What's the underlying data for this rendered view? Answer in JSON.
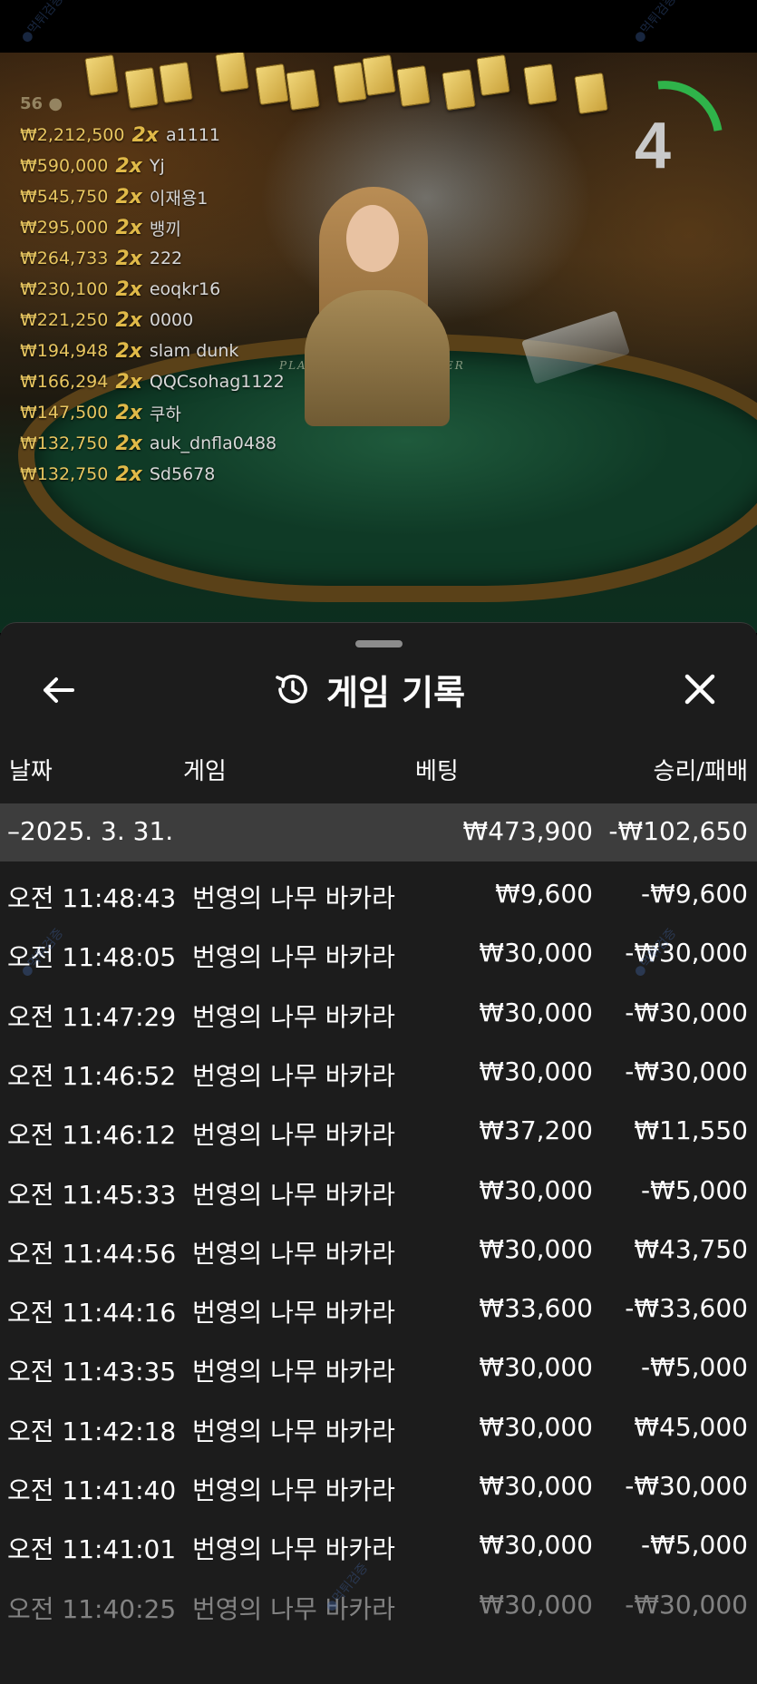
{
  "scene": {
    "online_count": "56",
    "timer_value": "4",
    "table_labels": [
      "PLAYER",
      "BANKER"
    ],
    "bets": [
      {
        "amount": "₩2,212,500",
        "mult": "2x",
        "name": "a1111"
      },
      {
        "amount": "₩590,000",
        "mult": "2x",
        "name": "Yj"
      },
      {
        "amount": "₩545,750",
        "mult": "2x",
        "name": "이재용1"
      },
      {
        "amount": "₩295,000",
        "mult": "2x",
        "name": "뱅끼"
      },
      {
        "amount": "₩264,733",
        "mult": "2x",
        "name": "222"
      },
      {
        "amount": "₩230,100",
        "mult": "2x",
        "name": "eoqkr16"
      },
      {
        "amount": "₩221,250",
        "mult": "2x",
        "name": "0000"
      },
      {
        "amount": "₩194,948",
        "mult": "2x",
        "name": "slam dunk"
      },
      {
        "amount": "₩166,294",
        "mult": "2x",
        "name": "QQCsohag1122"
      },
      {
        "amount": "₩147,500",
        "mult": "2x",
        "name": "쿠하"
      },
      {
        "amount": "₩132,750",
        "mult": "2x",
        "name": "auk_dnfla0488"
      },
      {
        "amount": "₩132,750",
        "mult": "2x",
        "name": "Sd5678"
      }
    ]
  },
  "sheet": {
    "title": "게임 기록",
    "icons": {
      "back": "back-arrow-icon",
      "history": "history-icon",
      "close": "close-icon"
    },
    "columns": {
      "date": "날짜",
      "game": "게임",
      "bet": "베팅",
      "result": "승리/패배"
    },
    "summary": {
      "date": "–2025. 3. 31.",
      "bet": "₩473,900",
      "result": "-₩102,650"
    },
    "rows": [
      {
        "time": "오전 11:48:43",
        "game": "번영의 나무 바카라",
        "bet": "₩9,600",
        "result": "-₩9,600"
      },
      {
        "time": "오전 11:48:05",
        "game": "번영의 나무 바카라",
        "bet": "₩30,000",
        "result": "-₩30,000"
      },
      {
        "time": "오전 11:47:29",
        "game": "번영의 나무 바카라",
        "bet": "₩30,000",
        "result": "-₩30,000"
      },
      {
        "time": "오전 11:46:52",
        "game": "번영의 나무 바카라",
        "bet": "₩30,000",
        "result": "-₩30,000"
      },
      {
        "time": "오전 11:46:12",
        "game": "번영의 나무 바카라",
        "bet": "₩37,200",
        "result": "₩11,550"
      },
      {
        "time": "오전 11:45:33",
        "game": "번영의 나무 바카라",
        "bet": "₩30,000",
        "result": "-₩5,000"
      },
      {
        "time": "오전 11:44:56",
        "game": "번영의 나무 바카라",
        "bet": "₩30,000",
        "result": "₩43,750"
      },
      {
        "time": "오전 11:44:16",
        "game": "번영의 나무 바카라",
        "bet": "₩33,600",
        "result": "-₩33,600"
      },
      {
        "time": "오전 11:43:35",
        "game": "번영의 나무 바카라",
        "bet": "₩30,000",
        "result": "-₩5,000"
      },
      {
        "time": "오전 11:42:18",
        "game": "번영의 나무 바카라",
        "bet": "₩30,000",
        "result": "₩45,000"
      },
      {
        "time": "오전 11:41:40",
        "game": "번영의 나무 바카라",
        "bet": "₩30,000",
        "result": "-₩30,000"
      },
      {
        "time": "오전 11:41:01",
        "game": "번영의 나무 바카라",
        "bet": "₩30,000",
        "result": "-₩5,000"
      },
      {
        "time": "오전 11:40:25",
        "game": "번영의 나무 바카라",
        "bet": "₩30,000",
        "result": "-₩30,000"
      }
    ]
  },
  "colors": {
    "sheet_bg": "#1c1c1c",
    "summary_bg": "#3d3d3d",
    "bet_amount": "#e8c660",
    "timer_arc": "#2fb34a"
  }
}
